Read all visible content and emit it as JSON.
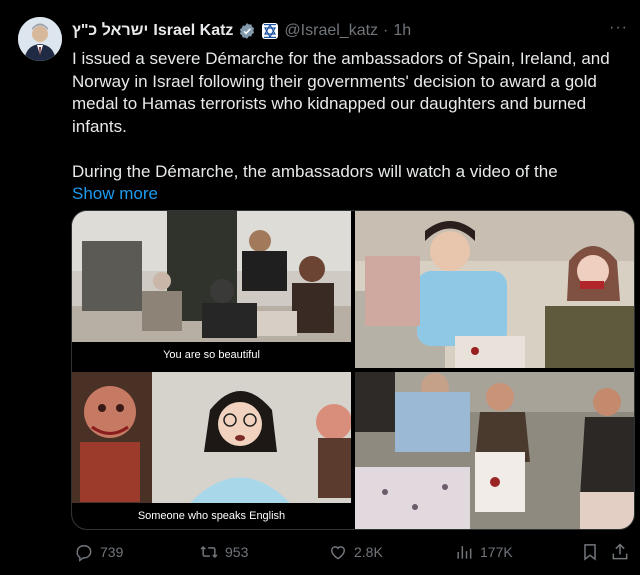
{
  "post": {
    "author_name_hebrew": "ישראל כ\"ץ",
    "author_name": "Israel Katz",
    "handle": "@Israel_katz",
    "separator": "·",
    "time": "1h",
    "paragraph1": "I issued a severe Démarche for the ambassadors of Spain, Ireland, and Norway in Israel following their governments' decision to award a gold medal to Hamas terrorists who kidnapped our daughters and burned infants.",
    "paragraph2": "During the Démarche, the ambassadors will watch a video of the",
    "show_more": "Show more",
    "more_label": "···"
  },
  "media": {
    "captions": [
      "You are so beautiful",
      "",
      "Someone who speaks English",
      ""
    ]
  },
  "actions": {
    "replies": "739",
    "reposts": "953",
    "likes": "2.8K",
    "views": "177K"
  },
  "colors": {
    "accent": "#1d9bf0",
    "muted": "#71767b",
    "verified_gold": "#e2b719"
  },
  "icons": [
    "reply-icon",
    "repost-icon",
    "like-icon",
    "views-icon",
    "bookmark-icon",
    "share-icon",
    "verified-badge-icon",
    "affiliate-badge-icon"
  ]
}
